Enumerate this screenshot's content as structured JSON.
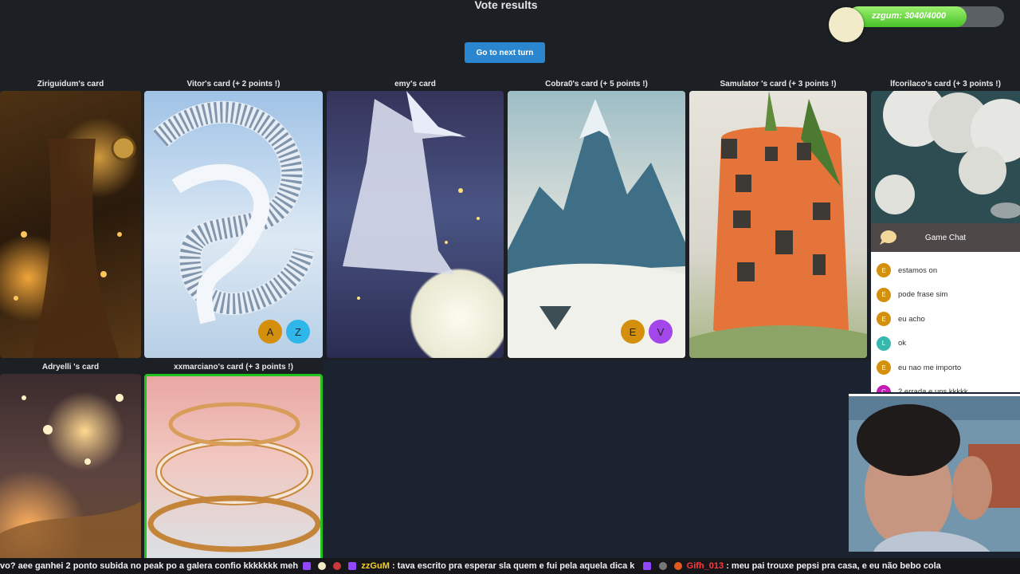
{
  "title": "Vote results",
  "next_button": "Go to next turn",
  "progress": {
    "label": "zzgum: 3040/4000",
    "value": 3040,
    "max": 4000
  },
  "cards": [
    {
      "label": "Ziriguidum's card",
      "voters": []
    },
    {
      "label": "Vitor's card (+ 2 points !)",
      "voters": [
        {
          "initial": "A",
          "color": "#d4900c"
        },
        {
          "initial": "Z",
          "color": "#2fb6ea"
        }
      ]
    },
    {
      "label": "emy's card",
      "voters": []
    },
    {
      "label": "Cobra0's card (+ 5 points !)",
      "voters": [
        {
          "initial": "E",
          "color": "#d4900c"
        },
        {
          "initial": "V",
          "color": "#a447ea"
        }
      ]
    },
    {
      "label": "Samulator 's card (+ 3 points !)",
      "voters": []
    },
    {
      "label": "lfcorilaco's card (+ 3 points !)",
      "voters": []
    },
    {
      "label": "Adryelli 's card",
      "voters": []
    },
    {
      "label": "xxmarciano's card (+ 3 points !)",
      "voters": []
    }
  ],
  "chat": {
    "title": "Game Chat",
    "messages": [
      {
        "initial": "E",
        "color": "#d4900c",
        "text": "estamos on"
      },
      {
        "initial": "E",
        "color": "#d4900c",
        "text": "pode frase sim"
      },
      {
        "initial": "E",
        "color": "#d4900c",
        "text": "eu acho"
      },
      {
        "initial": "L",
        "color": "#36b8ae",
        "text": "ok"
      },
      {
        "initial": "E",
        "color": "#d4900c",
        "text": "eu nao me importo"
      },
      {
        "initial": "C",
        "color": "#c21db4",
        "text": "2 errada e uns kkkkk"
      }
    ]
  },
  "ticker": {
    "part1": "vo?  aee ganhei 2 ponto  subida no peak po  a galera confio  kkkkkkk  meh",
    "user1": "zzGuM",
    "msg1": ":  tava escrito pra esperar sla quem e fui pela aquela dica k",
    "user2": "Gifh_013",
    "msg2": ":  meu pai trouxe pepsi pra casa, e eu não bebo cola",
    "user1_color": "#f5d320",
    "user2_color": "#ff3b3b"
  }
}
